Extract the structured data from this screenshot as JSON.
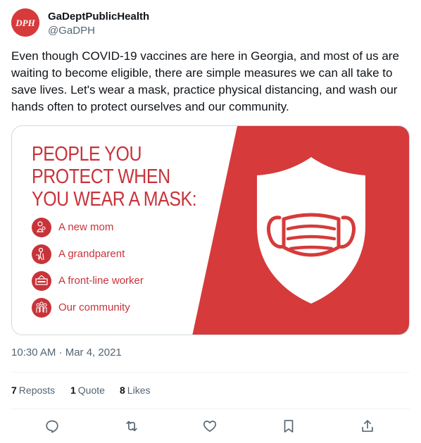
{
  "author": {
    "display_name": "GaDeptPublicHealth",
    "handle": "@GaDPH",
    "avatar_text": "DPH"
  },
  "tweet": {
    "text": "Even though COVID-19 vaccines are here in Georgia, and most of us are waiting to become eligible, there are simple measures we can all take to save lives. Let's wear a mask, practice physical distancing, and wash our hands often to protect ourselves and our community.",
    "timestamp": "10:30 AM · Mar 4, 2021"
  },
  "card": {
    "headline": [
      "PEOPLE YOU",
      "PROTECT WHEN",
      "YOU WEAR A MASK:"
    ],
    "people": [
      {
        "label": "A new mom",
        "icon": "mother-baby-icon"
      },
      {
        "label": "A grandparent",
        "icon": "grandparent-icon"
      },
      {
        "label": "A front-line worker",
        "icon": "open-sign-icon"
      },
      {
        "label": "Our community",
        "icon": "community-icon"
      }
    ],
    "colors": {
      "accent": "#c8333a",
      "panel": "#d63a3a"
    }
  },
  "stats": {
    "reposts_count": "7",
    "reposts_label": "Reposts",
    "quotes_count": "1",
    "quotes_label": "Quote",
    "likes_count": "8",
    "likes_label": "Likes"
  },
  "actions": [
    "reply-icon",
    "repost-icon",
    "like-icon",
    "bookmark-icon",
    "share-icon"
  ]
}
